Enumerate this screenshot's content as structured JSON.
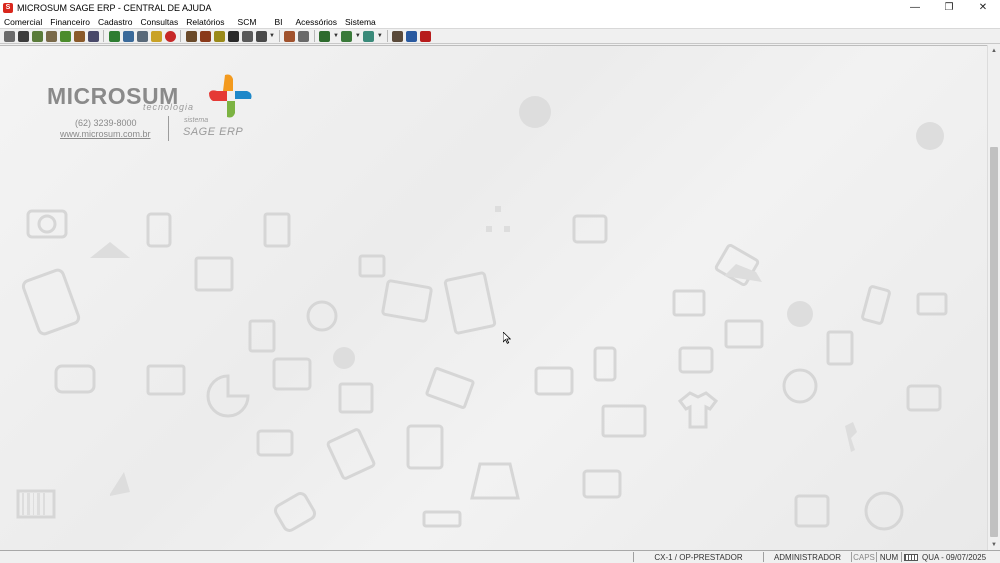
{
  "window": {
    "title": "MICROSUM SAGE ERP - CENTRAL DE AJUDA",
    "icon_letter": "S",
    "minimize": "—",
    "maximize": "❐",
    "close": "✕"
  },
  "menu": [
    "Comercial",
    "Financeiro",
    "Cadastro",
    "Consultas",
    "Relatórios",
    "SCM",
    "BI",
    "Acessórios",
    "Sistema"
  ],
  "toolbar_icons": [
    "printer-icon",
    "cart-icon",
    "box-icon",
    "ledger-icon",
    "money-icon",
    "stamp-icon",
    "refresh-icon",
    "book-icon",
    "folder-icon",
    "document-icon",
    "coins-icon",
    "target-icon",
    "handshake-icon",
    "gears-icon",
    "calculator-icon",
    "barcode-icon",
    "network-icon",
    "gift-icon",
    "stack-icon",
    "report-icon",
    "return-icon",
    "checklist-icon",
    "notes-icon",
    "briefcase-icon",
    "globe-icon",
    "exit-icon"
  ],
  "logo": {
    "brand": "MICROSUM",
    "tagline": "tecnologia",
    "phone": "(62) 3239-8000",
    "website": "www.microsum.com.br",
    "product_prefix": "sistema",
    "product": "SAGE ERP"
  },
  "status": {
    "blank": "",
    "cashier": "CX-1 / OP-PRESTADOR",
    "user": "ADMINISTRADOR",
    "caps": "CAPS",
    "num": "NUM",
    "date": "QUA - 09/07/2025"
  },
  "colors": {
    "logo_orange": "#f39a1e",
    "logo_blue": "#1e88c9",
    "logo_green": "#7cb342",
    "logo_gray": "#8a8a8a",
    "app_red": "#d9261c"
  }
}
